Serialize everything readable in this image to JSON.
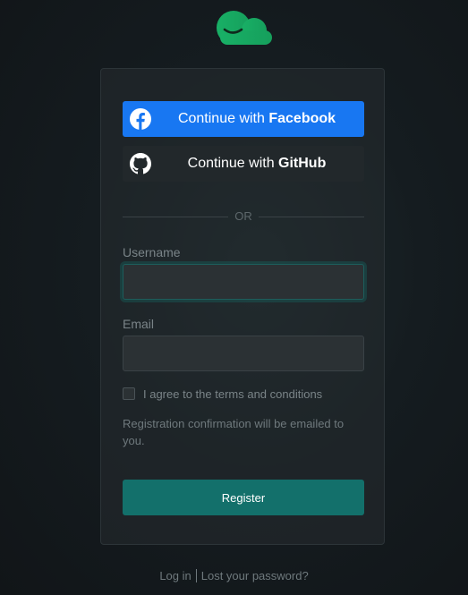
{
  "logo": {
    "icon": "smiling-cloud-icon",
    "color": "#1aa862"
  },
  "social": {
    "facebook": {
      "prefix": "Continue with ",
      "name": "Facebook",
      "icon": "facebook-icon",
      "color": "#1877f2"
    },
    "github": {
      "prefix": "Continue with ",
      "name": "GitHub",
      "icon": "github-icon",
      "color": "#22282b"
    }
  },
  "divider": {
    "label": "OR"
  },
  "form": {
    "username": {
      "label": "Username",
      "value": ""
    },
    "email": {
      "label": "Email",
      "value": ""
    },
    "terms": {
      "label": "I agree to the terms and conditions",
      "checked": false
    },
    "note": "Registration confirmation will be emailed to you.",
    "submit_label": "Register",
    "accent": "#13706b"
  },
  "footer": {
    "login": "Log in",
    "lost_password": "Lost your password?"
  }
}
